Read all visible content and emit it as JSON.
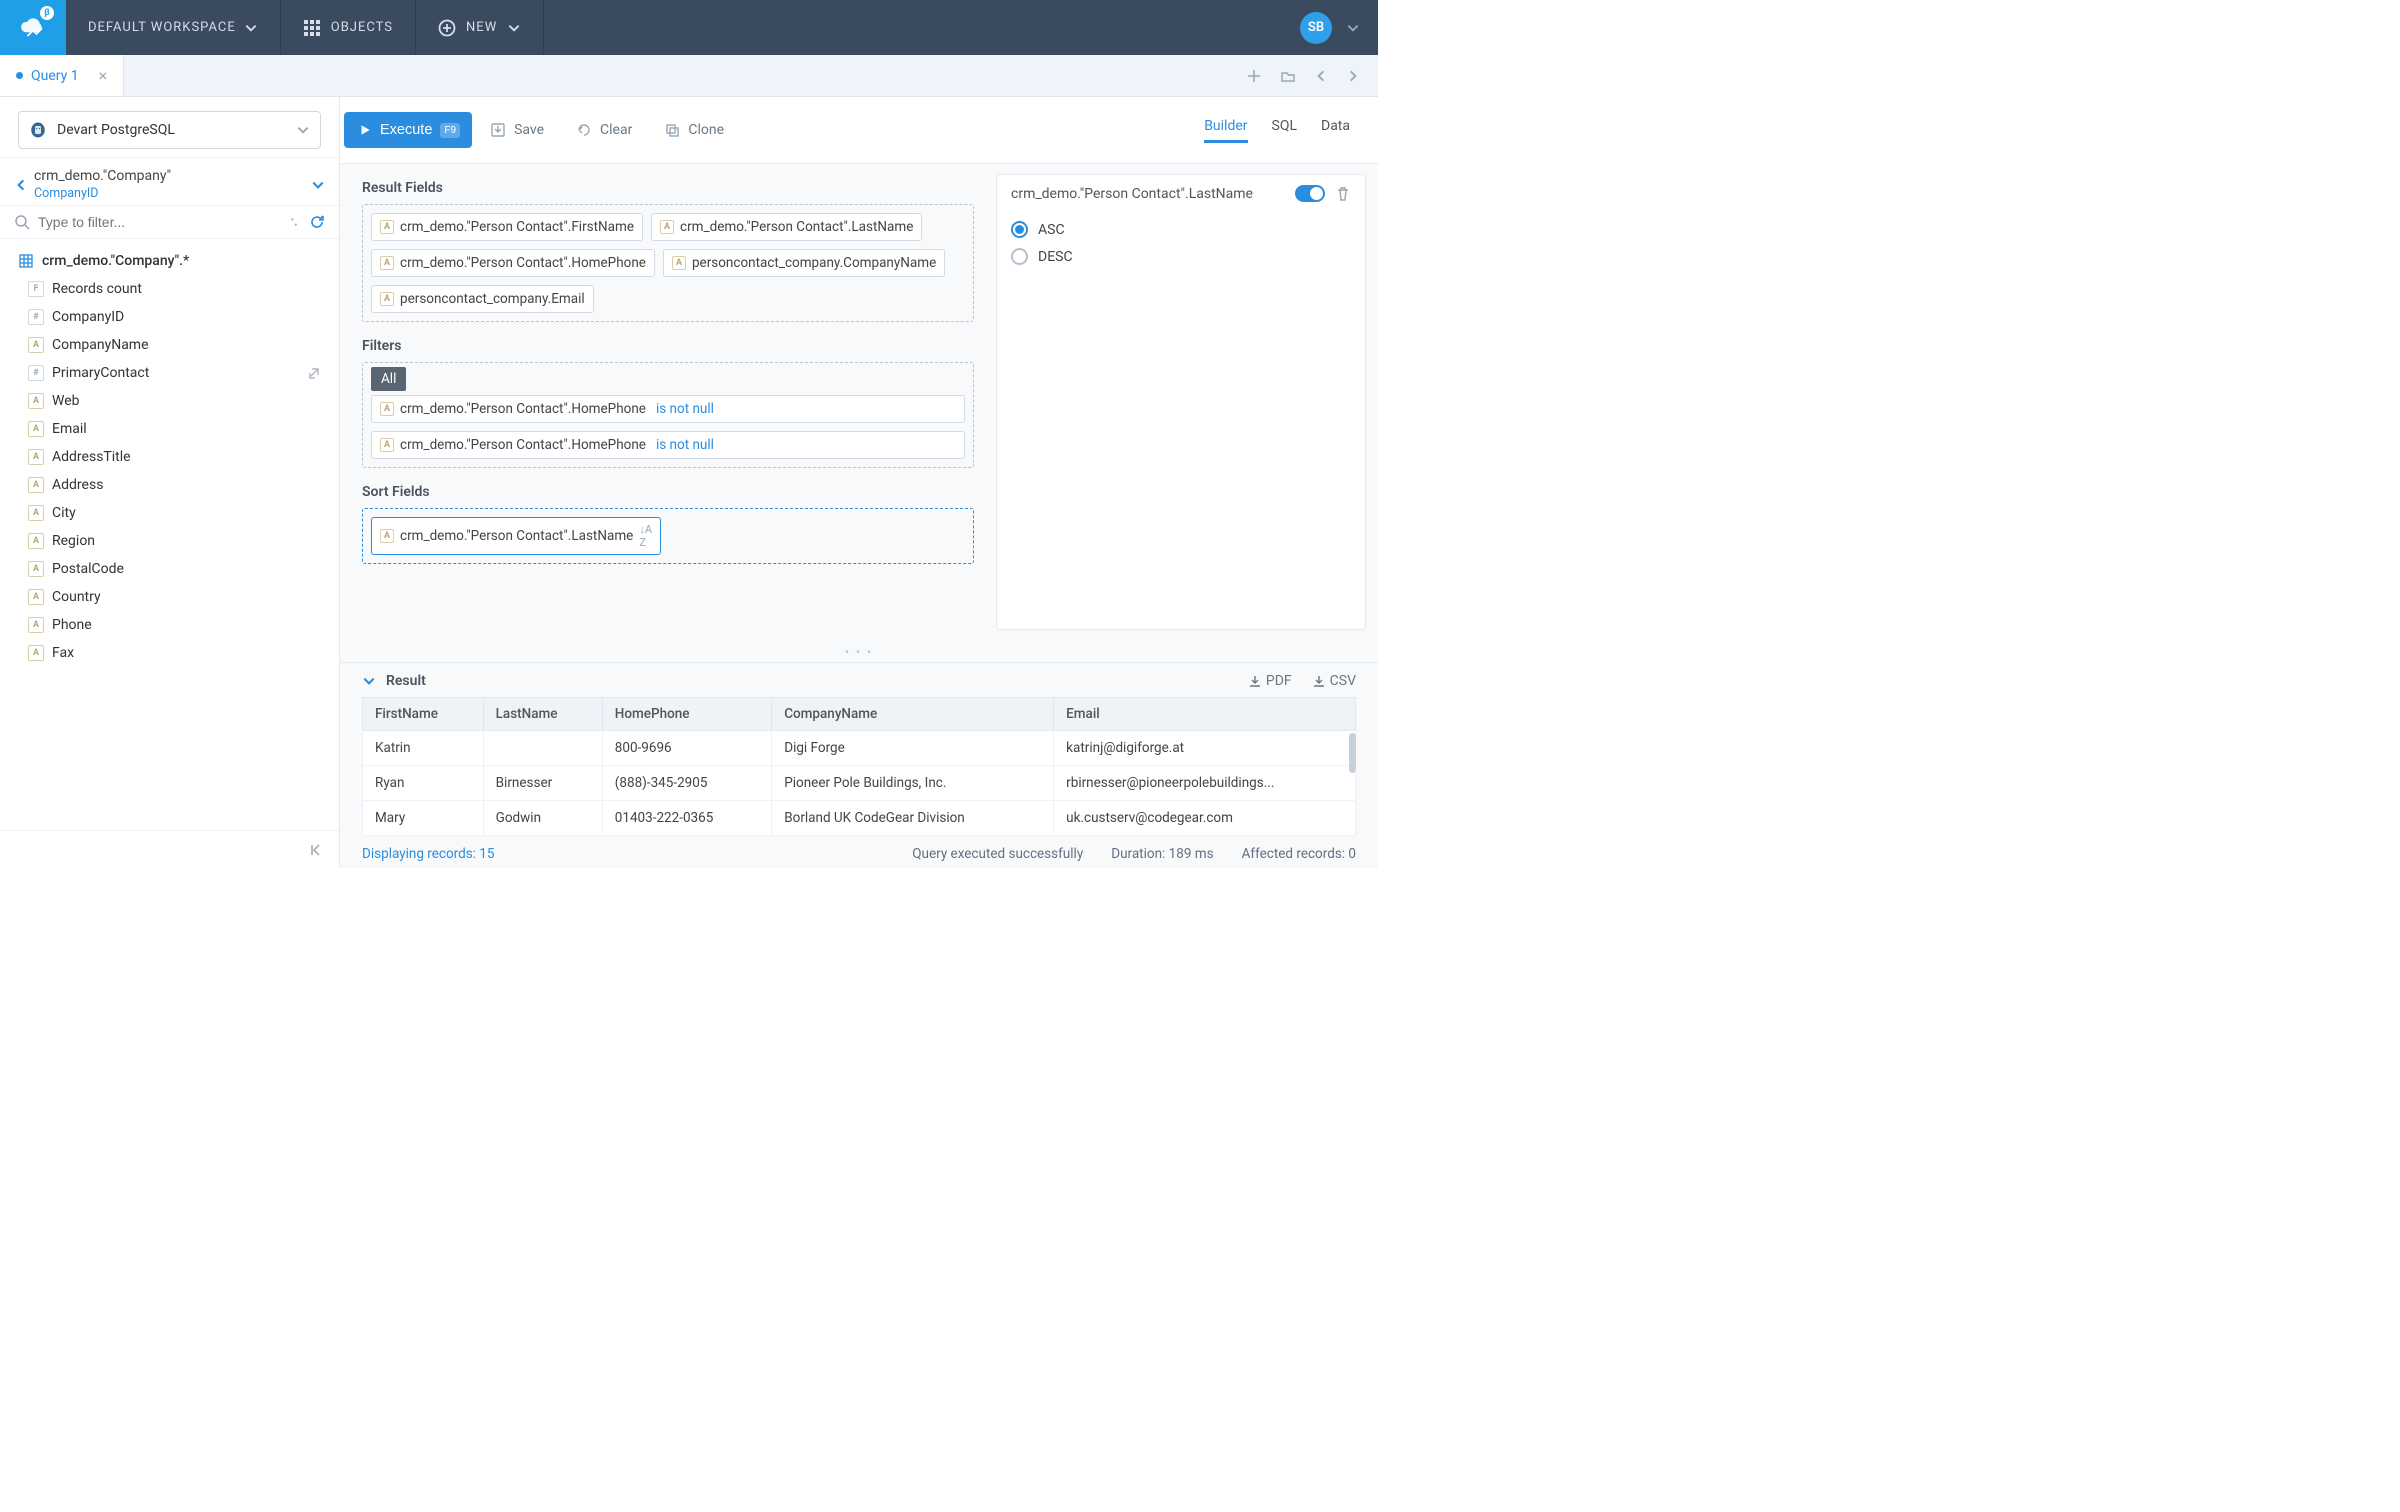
{
  "topbar": {
    "workspace": "DEFAULT WORKSPACE",
    "objects": "OBJECTS",
    "new": "NEW",
    "avatar_initials": "SB",
    "logo_badge": "β"
  },
  "tabs": [
    {
      "label": "Query 1"
    }
  ],
  "connection": {
    "name": "Devart PostgreSQL"
  },
  "breadcrumb": {
    "title": "crm_demo.\"Company\"",
    "sub": "CompanyID"
  },
  "filter": {
    "placeholder": "Type to filter..."
  },
  "tree": {
    "root": "crm_demo.\"Company\".*",
    "items": [
      {
        "type": "F",
        "label": "Records count"
      },
      {
        "type": "#",
        "label": "CompanyID"
      },
      {
        "type": "A",
        "label": "CompanyName"
      },
      {
        "type": "#",
        "label": "PrimaryContact",
        "ext": true
      },
      {
        "type": "A",
        "label": "Web"
      },
      {
        "type": "A",
        "label": "Email"
      },
      {
        "type": "A",
        "label": "AddressTitle"
      },
      {
        "type": "A",
        "label": "Address"
      },
      {
        "type": "A",
        "label": "City"
      },
      {
        "type": "A",
        "label": "Region"
      },
      {
        "type": "A",
        "label": "PostalCode"
      },
      {
        "type": "A",
        "label": "Country"
      },
      {
        "type": "A",
        "label": "Phone"
      },
      {
        "type": "A",
        "label": "Fax"
      }
    ]
  },
  "toolbar": {
    "execute": "Execute",
    "execute_key": "F9",
    "save": "Save",
    "clear": "Clear",
    "clone": "Clone"
  },
  "modes": {
    "builder": "Builder",
    "sql": "SQL",
    "data": "Data"
  },
  "builder": {
    "result_fields_title": "Result Fields",
    "result_fields": [
      "crm_demo.\"Person Contact\".FirstName",
      "crm_demo.\"Person Contact\".LastName",
      "crm_demo.\"Person Contact\".HomePhone",
      "personcontact_company.CompanyName",
      "personcontact_company.Email"
    ],
    "filters_title": "Filters",
    "filters_mode": "All",
    "filters": [
      {
        "field": "crm_demo.\"Person Contact\".HomePhone",
        "op": "is not null"
      },
      {
        "field": "crm_demo.\"Person Contact\".HomePhone",
        "op": "is not null"
      }
    ],
    "sort_title": "Sort Fields",
    "sort_fields": [
      {
        "field": "crm_demo.\"Person Contact\".LastName"
      }
    ]
  },
  "side_panel": {
    "field": "crm_demo.\"Person Contact\".LastName",
    "asc": "ASC",
    "desc": "DESC"
  },
  "result": {
    "title": "Result",
    "pdf": "PDF",
    "csv": "CSV",
    "columns": [
      "FirstName",
      "LastName",
      "HomePhone",
      "CompanyName",
      "Email"
    ],
    "rows": [
      [
        "Katrin",
        "",
        "800-9696",
        "Digi Forge",
        "katrinj@digiforge.at"
      ],
      [
        "Ryan",
        "Birnesser",
        "(888)-345-2905",
        "Pioneer Pole Buildings, Inc.",
        "rbirnesser@pioneerpolebuildings..."
      ],
      [
        "Mary",
        "Godwin",
        "01403-222-0365",
        "Borland UK CodeGear Division",
        "uk.custserv@codegear.com"
      ]
    ]
  },
  "status": {
    "displaying": "Displaying records: 15",
    "success": "Query executed successfully",
    "duration": "Duration: 189 ms",
    "affected": "Affected records: 0"
  }
}
